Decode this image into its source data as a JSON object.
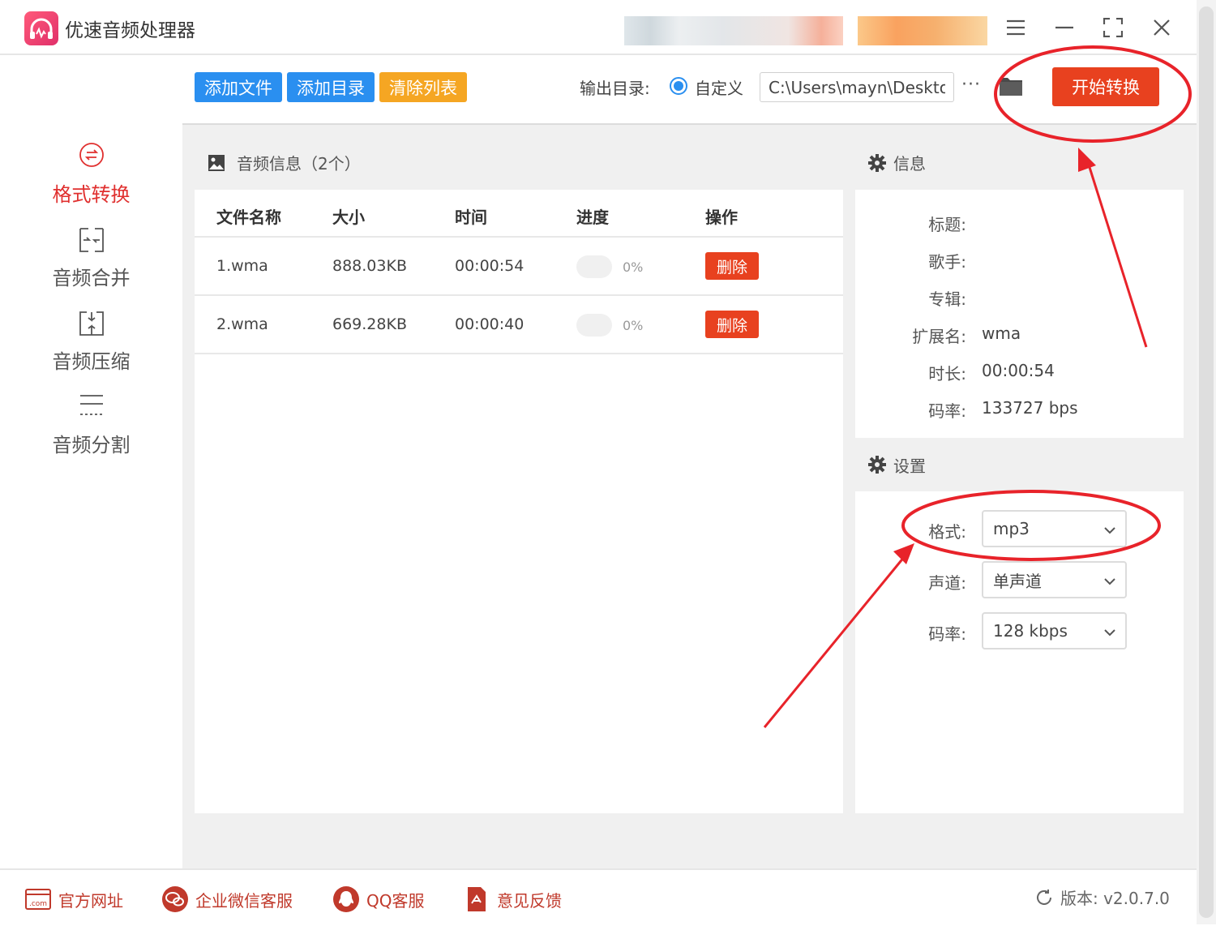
{
  "app": {
    "title": "优速音频处理器",
    "window_controls": [
      "menu-icon",
      "minimize-icon",
      "fullscreen-icon",
      "close-icon"
    ]
  },
  "sidebar": {
    "items": [
      {
        "label": "格式转换",
        "icon": "format-convert-icon",
        "active": true
      },
      {
        "label": "音频合并",
        "icon": "audio-merge-icon",
        "active": false
      },
      {
        "label": "音频压缩",
        "icon": "audio-compress-icon",
        "active": false
      },
      {
        "label": "音频分割",
        "icon": "audio-split-icon",
        "active": false
      }
    ]
  },
  "toolbar": {
    "add_file": "添加文件",
    "add_dir": "添加目录",
    "clear_list": "清除列表",
    "output_label": "输出目录:",
    "custom_label": "自定义",
    "output_path": "C:\\Users\\mayn\\Desktop",
    "more": "···",
    "start": "开始转换"
  },
  "audio_panel": {
    "title": "音频信息（2个）",
    "columns": [
      "文件名称",
      "大小",
      "时间",
      "进度",
      "操作"
    ],
    "rows": [
      {
        "name": "1.wma",
        "size": "888.03KB",
        "time": "00:00:54",
        "progress": "0%",
        "action": "删除"
      },
      {
        "name": "2.wma",
        "size": "669.28KB",
        "time": "00:00:40",
        "progress": "0%",
        "action": "删除"
      }
    ]
  },
  "info_panel": {
    "title": "信息",
    "fields": [
      {
        "label": "标题:",
        "value": ""
      },
      {
        "label": "歌手:",
        "value": ""
      },
      {
        "label": "专辑:",
        "value": ""
      },
      {
        "label": "扩展名:",
        "value": "wma"
      },
      {
        "label": "时长:",
        "value": "00:00:54"
      },
      {
        "label": "码率:",
        "value": "133727 bps"
      }
    ]
  },
  "settings_panel": {
    "title": "设置",
    "fields": [
      {
        "label": "格式:",
        "value": "mp3"
      },
      {
        "label": "声道:",
        "value": "单声道"
      },
      {
        "label": "码率:",
        "value": "128 kbps"
      }
    ]
  },
  "footer": {
    "links": [
      {
        "label": "官方网址",
        "icon": "website-icon"
      },
      {
        "label": "企业微信客服",
        "icon": "wechat-service-icon"
      },
      {
        "label": "QQ客服",
        "icon": "qq-icon"
      },
      {
        "label": "意见反馈",
        "icon": "feedback-icon"
      }
    ],
    "version": "版本: v2.0.7.0"
  },
  "colors": {
    "accent_red": "#e8411f",
    "active_red": "#e0302f",
    "blue_button": "#2a8ff0",
    "orange_button": "#f5a623",
    "annotation_red": "#e8232a"
  }
}
